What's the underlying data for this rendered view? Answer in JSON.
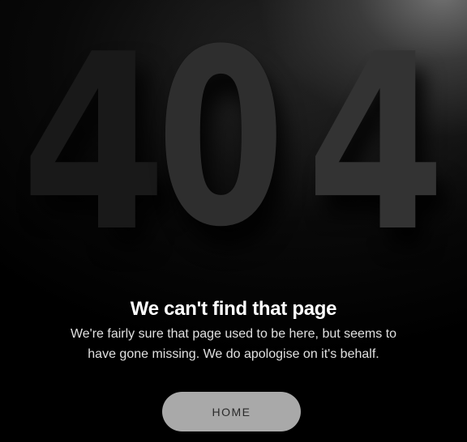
{
  "error_code": {
    "digits": [
      "4",
      "0",
      "4"
    ]
  },
  "message": {
    "heading": "We can't find that page",
    "body": "We're fairly sure that page used to be here, but seems to have gone missing. We do apologise on it's behalf."
  },
  "actions": {
    "home_label": "HOME"
  },
  "colors": {
    "background": "#000000",
    "button": "#a9a9a9",
    "heading": "#ffffff"
  }
}
